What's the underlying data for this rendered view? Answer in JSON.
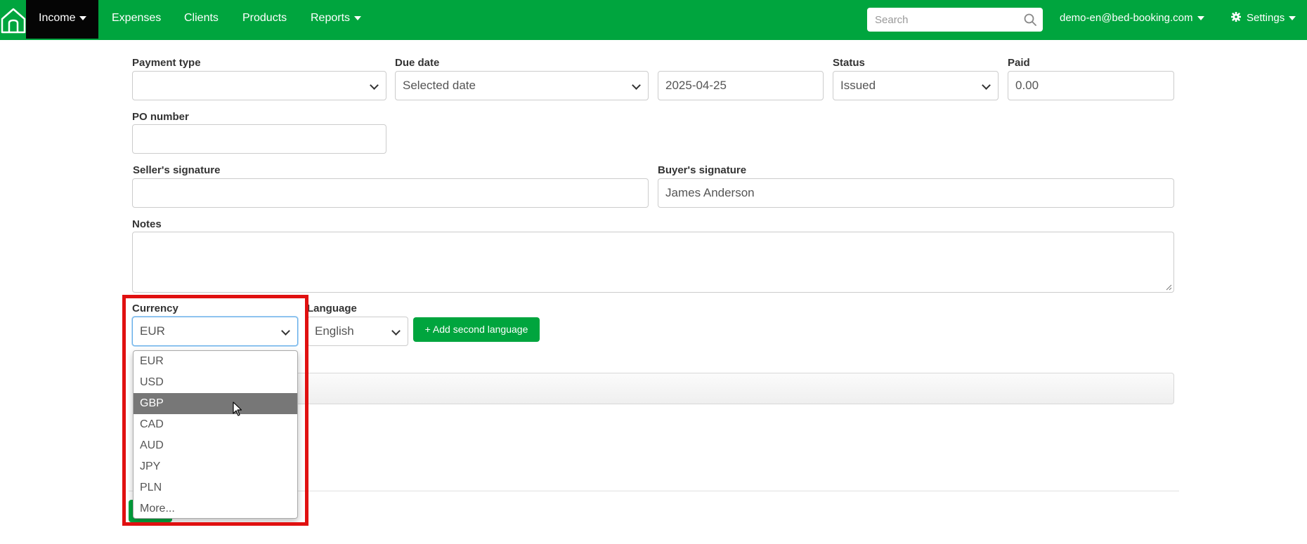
{
  "nav": {
    "items": [
      {
        "label": "Income",
        "active": true,
        "caret": true
      },
      {
        "label": "Expenses",
        "active": false,
        "caret": false
      },
      {
        "label": "Clients",
        "active": false,
        "caret": false
      },
      {
        "label": "Products",
        "active": false,
        "caret": false
      },
      {
        "label": "Reports",
        "active": false,
        "caret": true
      }
    ],
    "search_placeholder": "Search",
    "account_email": "demo-en@bed-booking.com",
    "settings_label": "Settings",
    "brand_color": "#00a53e"
  },
  "form": {
    "payment_type": {
      "label": "Payment type",
      "value": ""
    },
    "due_date": {
      "label": "Due date",
      "value": "Selected date",
      "date": "2025-04-25"
    },
    "status": {
      "label": "Status",
      "value": "Issued"
    },
    "paid": {
      "label": "Paid",
      "value": "0.00"
    },
    "po_number": {
      "label": "PO number",
      "value": ""
    },
    "seller_signature": {
      "label": "Seller's signature",
      "value": ""
    },
    "buyer_signature": {
      "label": "Buyer's signature",
      "value": "James Anderson"
    },
    "notes": {
      "label": "Notes",
      "value": ""
    },
    "currency": {
      "label": "Currency",
      "value": "EUR",
      "options": [
        "EUR",
        "USD",
        "GBP",
        "CAD",
        "AUD",
        "JPY",
        "PLN",
        "More..."
      ],
      "hovered": "GBP"
    },
    "language": {
      "label": "Language",
      "value": "English"
    },
    "add_second_language_label": "+ Add second language"
  },
  "annotation": {
    "highlight_color": "#e01010"
  }
}
